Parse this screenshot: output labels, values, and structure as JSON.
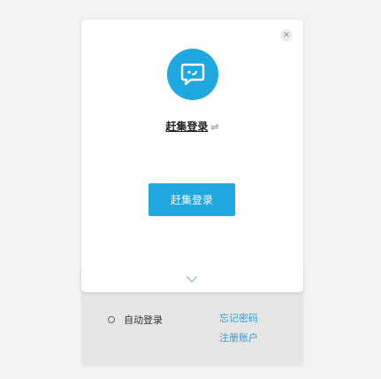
{
  "dialog": {
    "close_label": "×",
    "title": "赶集登录",
    "title_suffix": "⇌",
    "login_button": "赶集登录",
    "logo_icon": "chat-bubble-icon",
    "expand_icon": "chevron-down-icon",
    "accent_color": "#1ea7e1"
  },
  "footer": {
    "auto_login": "自动登录",
    "forgot_password": "忘记密码",
    "register": "注册账户",
    "link_color": "#2a9fd6"
  }
}
